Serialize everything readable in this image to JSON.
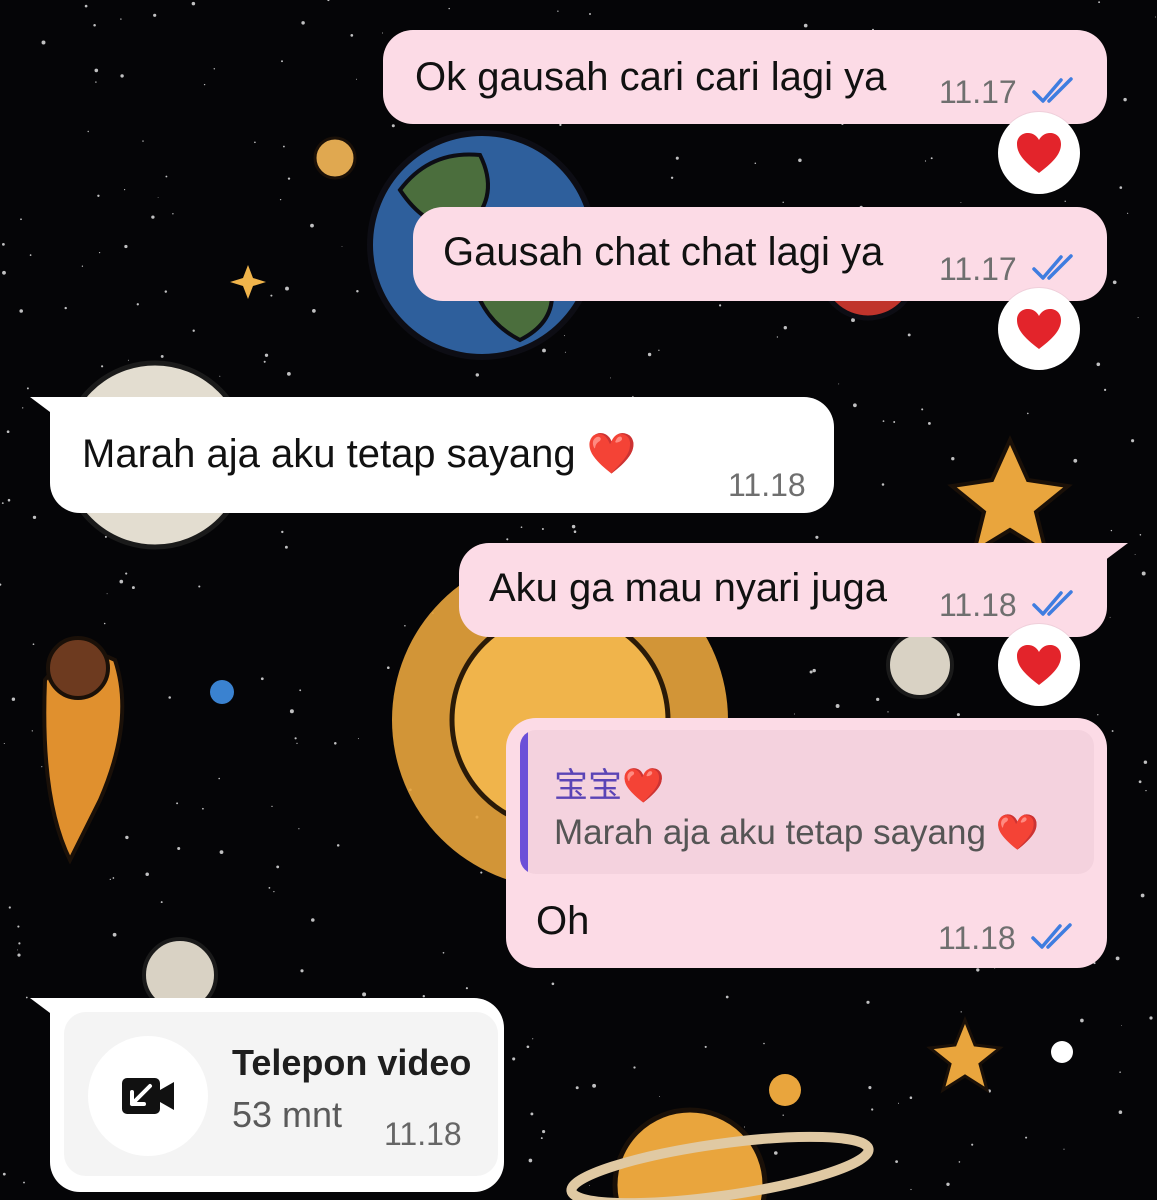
{
  "messages": [
    {
      "type": "outgoing",
      "text": "Ok gausah cari cari lagi ya",
      "time": "11.17",
      "reaction": "❤️"
    },
    {
      "type": "outgoing",
      "text": "Gausah chat chat lagi ya",
      "time": "11.17",
      "reaction": "❤️"
    },
    {
      "type": "incoming",
      "text": "Marah aja aku tetap sayang ❤️",
      "time": "11.18"
    },
    {
      "type": "outgoing",
      "text": "Aku ga mau nyari juga",
      "time": "11.18",
      "reaction": "❤️"
    },
    {
      "type": "outgoing-reply",
      "quote_name": "宝宝❤️",
      "quote_text": "Marah aja aku tetap sayang ❤️",
      "text": "Oh",
      "time": "11.18"
    },
    {
      "type": "incoming-call",
      "title": "Telepon video",
      "duration": "53 mnt",
      "time": "11.18"
    }
  ],
  "colors": {
    "outgoing_bubble": "#fcdbe6",
    "incoming_bubble": "#ffffff",
    "read_ticks": "#3f7de0",
    "quote_bar": "#6b50d8",
    "background": "#050507"
  },
  "icons": {
    "read_status": "double-check-icon",
    "reaction": "red-heart-emoji",
    "call": "video-call-missed-arrow-icon"
  }
}
